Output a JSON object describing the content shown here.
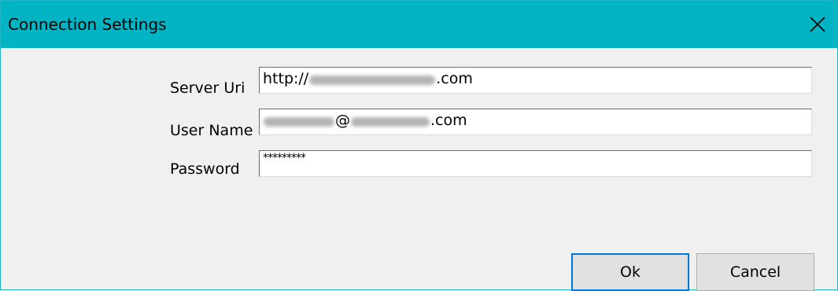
{
  "window": {
    "title": "Connection Settings",
    "title_bar_color": "#00b4c4"
  },
  "icons": {
    "close": "close-icon"
  },
  "form": {
    "server_uri_label": "Server Uri",
    "server_uri_prefix": "http://",
    "server_uri_suffix": ".com",
    "user_name_label": "User Name",
    "user_name_at": "@",
    "user_name_suffix": ".com",
    "password_label": "Password",
    "password_value": "*********"
  },
  "buttons": {
    "ok": "Ok",
    "cancel": "Cancel"
  }
}
